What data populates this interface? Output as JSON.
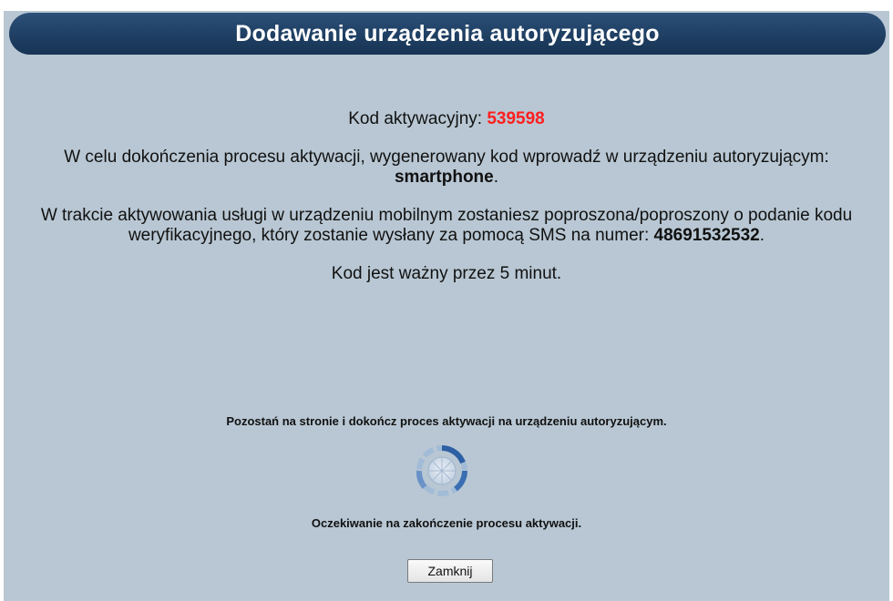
{
  "header": {
    "title": "Dodawanie urządzenia autoryzującego"
  },
  "activation": {
    "code_label": "Kod aktywacyjny: ",
    "code_value": "539598",
    "code_color": "#ff1f1f",
    "instruction_text": "W celu dokończenia procesu aktywacji, wygenerowany kod wprowadź w urządzeniu autoryzującym: ",
    "device_name": "smartphone",
    "instruction_end": ".",
    "sms_text": "W trakcie aktywowania usługi w urządzeniu mobilnym zostaniesz poproszona/poproszony o podanie kodu weryfikacyjnego, który zostanie wysłany za pomocą SMS na numer: ",
    "phone_number": "48691532532",
    "sms_end": ".",
    "validity_text": "Kod jest ważny przez 5 minut."
  },
  "status": {
    "stay_on_page_text": "Pozostań na stronie i dokończ proces aktywacji na urządzeniu autoryzującym.",
    "waiting_text": "Oczekiwanie na zakończenie procesu aktywacji.",
    "spinner_icon": "loading-spinner-icon"
  },
  "actions": {
    "close_label": "Zamknij"
  },
  "colors": {
    "panel_background": "#b8c7d3",
    "header_background": "#1f3f63",
    "header_text": "#ffffff"
  }
}
